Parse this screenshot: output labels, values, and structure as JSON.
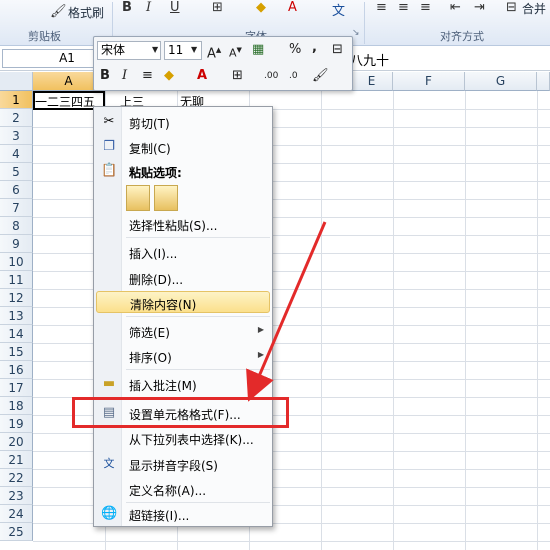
{
  "ribbon": {
    "format_painter_label": "格式刷",
    "clipboard_group": "剪贴板",
    "font_group": "字体",
    "alignment_group": "对齐方式",
    "merge_label": "合并"
  },
  "formula_bar": {
    "name_box": "A1",
    "content": "八九十"
  },
  "columns": [
    "A",
    "B",
    "C",
    "D",
    "E",
    "F",
    "G"
  ],
  "rows": [
    "1",
    "2",
    "3",
    "4",
    "5",
    "6",
    "7",
    "8",
    "9",
    "10",
    "11",
    "12",
    "13",
    "14",
    "15",
    "16",
    "17",
    "18",
    "19",
    "20",
    "21",
    "22",
    "23",
    "24",
    "25"
  ],
  "cells": {
    "A1": "一二三四五",
    "B1_fragment": "上三",
    "C1": "无聊"
  },
  "mini_toolbar": {
    "font_name": "宋体",
    "font_size": "11",
    "percent": "%",
    "comma": ","
  },
  "context_menu": {
    "items": [
      {
        "label": "剪切(T)",
        "icon": "scissors-icon"
      },
      {
        "label": "复制(C)",
        "icon": "copy-icon"
      },
      {
        "label": "粘贴选项:",
        "icon": "paste-icon"
      },
      {
        "label": "选择性粘贴(S)..."
      },
      {
        "label": "插入(I)..."
      },
      {
        "label": "删除(D)..."
      },
      {
        "label": "清除内容(N)"
      },
      {
        "label": "筛选(E)"
      },
      {
        "label": "排序(O)"
      },
      {
        "label": "插入批注(M)",
        "icon": "comment-icon"
      },
      {
        "label": "设置单元格格式(F)...",
        "icon": "format-cells-icon"
      },
      {
        "label": "从下拉列表中选择(K)..."
      },
      {
        "label": "显示拼音字段(S)",
        "icon": "phonetic-icon"
      },
      {
        "label": "定义名称(A)..."
      },
      {
        "label": "超链接(I)...",
        "icon": "hyperlink-icon"
      }
    ]
  },
  "colors": {
    "highlight": "#fbe08c",
    "annotation_red": "#e32a2a",
    "selected_header": "#f1c15f"
  }
}
